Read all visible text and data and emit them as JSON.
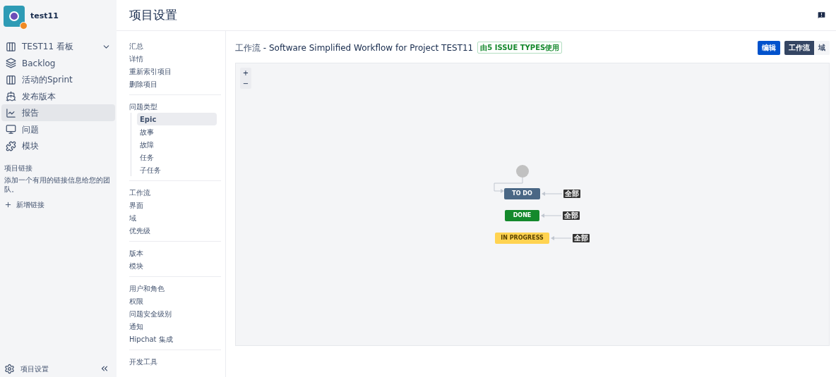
{
  "project": {
    "name": "test11"
  },
  "sidebar": {
    "items": [
      {
        "label": "TEST11 看板",
        "kind": "board",
        "selected": false,
        "expandable": true
      },
      {
        "label": "Backlog",
        "kind": "backlog",
        "selected": false
      },
      {
        "label": "活动的Sprint",
        "kind": "sprint",
        "selected": false
      },
      {
        "label": "发布版本",
        "kind": "release",
        "selected": false
      },
      {
        "label": "报告",
        "kind": "report",
        "selected": true
      },
      {
        "label": "问题",
        "kind": "issue",
        "selected": false
      },
      {
        "label": "模块",
        "kind": "module",
        "selected": false
      }
    ],
    "links_title": "项目链接",
    "links_hint": "添加一个有用的链接信息给您的团队。",
    "add_link": "新增链接",
    "footer": "项目设置"
  },
  "header": {
    "title": "项目设置"
  },
  "settings_nav": [
    [
      {
        "label": "汇总",
        "selected": false
      },
      {
        "label": "详情",
        "selected": false
      },
      {
        "label": "重新索引项目",
        "selected": false
      },
      {
        "label": "删除项目",
        "selected": false
      }
    ],
    [
      {
        "label": "问题类型",
        "selected": false,
        "children": [
          {
            "label": "Epic",
            "selected": true
          },
          {
            "label": "故事",
            "selected": false
          },
          {
            "label": "故障",
            "selected": false
          },
          {
            "label": "任务",
            "selected": false
          },
          {
            "label": "子任务",
            "selected": false
          }
        ]
      }
    ],
    [
      {
        "label": "工作流",
        "selected": false
      },
      {
        "label": "界面",
        "selected": false
      },
      {
        "label": "域",
        "selected": false
      },
      {
        "label": "优先级",
        "selected": false
      }
    ],
    [
      {
        "label": "版本",
        "selected": false
      },
      {
        "label": "模块",
        "selected": false
      }
    ],
    [
      {
        "label": "用户和角色",
        "selected": false
      },
      {
        "label": "权限",
        "selected": false
      },
      {
        "label": "问题安全级别",
        "selected": false
      },
      {
        "label": "通知",
        "selected": false
      },
      {
        "label": "Hipchat 集成",
        "selected": false
      }
    ],
    [
      {
        "label": "开发工具",
        "selected": false
      }
    ]
  ],
  "workflow": {
    "prefix": "工作流",
    "separator": "-",
    "title": "Software Simplified Workflow for Project TEST11",
    "badge": "由5 ISSUE TYPES使用",
    "actions": [
      {
        "label": "编辑",
        "kind": "primary"
      },
      {
        "label": "工作流",
        "kind": "dark"
      },
      {
        "label": "域",
        "kind": "plain"
      }
    ],
    "zoom": [
      "+",
      "−"
    ],
    "statuses": [
      {
        "name": "TO DO",
        "color": "#4a6785",
        "tag": "全部"
      },
      {
        "name": "DONE",
        "color": "#14892c",
        "tag": "全部"
      },
      {
        "name": "IN PROGRESS",
        "color": "#ffd351",
        "tag": "全部"
      }
    ]
  }
}
